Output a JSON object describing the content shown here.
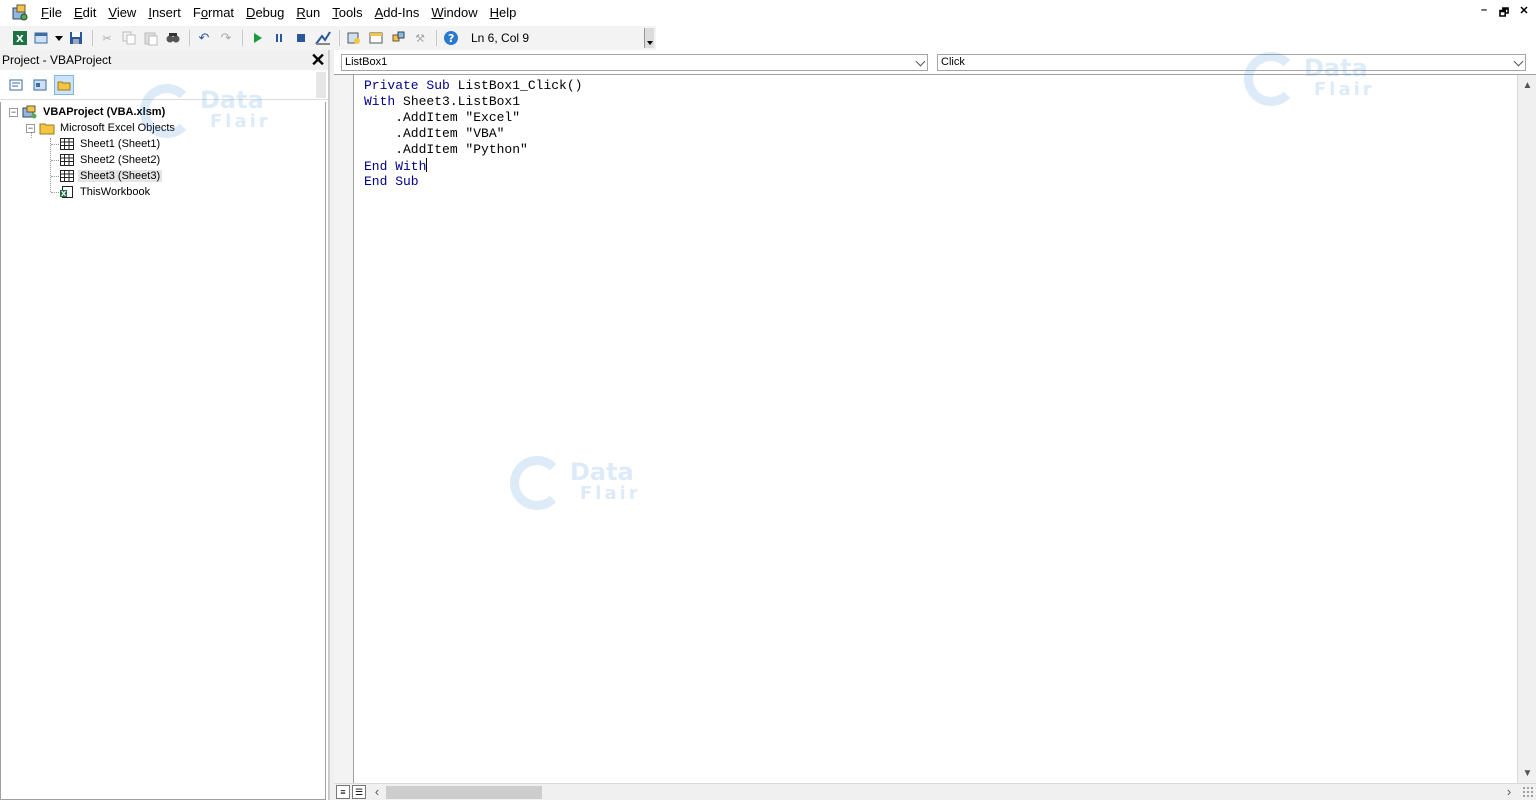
{
  "menubar": {
    "items": [
      {
        "label": "File",
        "accel": "F"
      },
      {
        "label": "Edit",
        "accel": "E"
      },
      {
        "label": "View",
        "accel": "V"
      },
      {
        "label": "Insert",
        "accel": "I"
      },
      {
        "label": "Format",
        "accel": "o"
      },
      {
        "label": "Debug",
        "accel": "D"
      },
      {
        "label": "Run",
        "accel": "R"
      },
      {
        "label": "Tools",
        "accel": "T"
      },
      {
        "label": "Add-Ins",
        "accel": "A"
      },
      {
        "label": "Window",
        "accel": "W"
      },
      {
        "label": "Help",
        "accel": "H"
      }
    ],
    "window_controls": {
      "minimize": "–",
      "restore": "🗗",
      "close": "✕"
    }
  },
  "toolbar": {
    "status": "Ln 6, Col 9"
  },
  "project_panel": {
    "title": "Project - VBAProject",
    "close_glyph": "✕",
    "tree": {
      "project": "VBAProject (VBA.xlsm)",
      "folder": "Microsoft Excel Objects",
      "items": [
        "Sheet1 (Sheet1)",
        "Sheet2 (Sheet2)",
        "Sheet3 (Sheet3)",
        "ThisWorkbook"
      ],
      "selected_index": 2
    }
  },
  "code_window": {
    "object_combo": "ListBox1",
    "procedure_combo": "Click",
    "lines": [
      [
        {
          "t": "Private Sub",
          "kw": true
        },
        {
          "t": " ListBox1_Click()",
          "kw": false
        }
      ],
      [
        {
          "t": "With",
          "kw": true
        },
        {
          "t": " Sheet3.ListBox1",
          "kw": false
        }
      ],
      [
        {
          "t": "    .AddItem \"Excel\"",
          "kw": false
        }
      ],
      [
        {
          "t": "    .AddItem \"VBA\"",
          "kw": false
        }
      ],
      [
        {
          "t": "    .AddItem \"Python\"",
          "kw": false
        }
      ],
      [
        {
          "t": "End With",
          "kw": true
        }
      ],
      [
        {
          "t": "End Sub",
          "kw": true
        }
      ]
    ],
    "caret_line": 5
  },
  "watermark": {
    "line1": "Data",
    "line2": "Flair"
  },
  "colors": {
    "keyword": "#00008b",
    "selection": "#e5e5e5",
    "watermark": "#4a90d9"
  }
}
